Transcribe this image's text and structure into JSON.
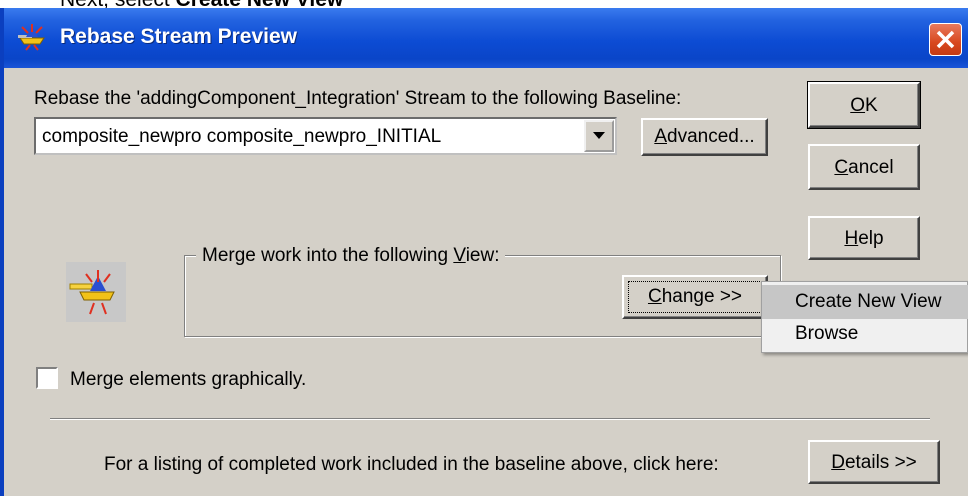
{
  "caption": {
    "prefix": "Next, select ",
    "bold": "Create New View"
  },
  "dialog": {
    "title": "Rebase Stream Preview",
    "rebase_label": "Rebase the 'addingComponent_Integration' Stream to the following Baseline:",
    "baseline_value": "composite_newpro  composite_newpro_INITIAL",
    "advanced_button": {
      "mnemonic": "A",
      "rest": "dvanced..."
    },
    "ok_button": {
      "mnemonic": "O",
      "rest": "K"
    },
    "cancel_button": {
      "mnemonic": "C",
      "rest": "ancel"
    },
    "help_button": {
      "mnemonic": "H",
      "rest": "elp"
    },
    "merge_group": {
      "prefix": "Merge work into the following ",
      "mnemonic": "V",
      "rest": "iew:"
    },
    "change_button": {
      "mnemonic": "C",
      "rest": "hange >>"
    },
    "context_menu": {
      "items": [
        "Create New View",
        "Browse"
      ]
    },
    "merge_checkbox": {
      "prefix": "Merge elements ",
      "mnemonic": "g",
      "rest": "raphically.",
      "checked": false
    },
    "details_label": "For a listing of completed work included in the baseline above, click here:",
    "details_button": {
      "mnemonic": "D",
      "rest": "etails >>"
    }
  },
  "colors": {
    "titlebar": "#0a45c8",
    "dialog_bg": "#d4d0c8",
    "close": "#d8481e"
  }
}
